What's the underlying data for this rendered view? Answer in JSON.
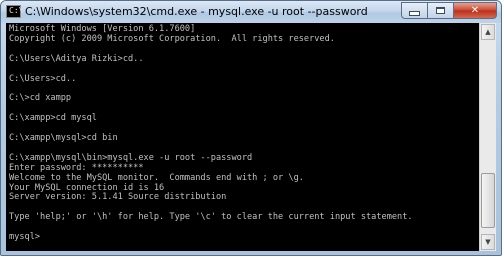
{
  "window": {
    "title": "C:\\Windows\\system32\\cmd.exe - mysql.exe  -u root --password",
    "icon_glyph": "C:\\",
    "buttons": {
      "minimize": "minimize",
      "maximize": "maximize",
      "close": "✕"
    }
  },
  "console": {
    "text_color": "#c0c0c0",
    "background": "#000000",
    "lines": [
      "Microsoft Windows [Version 6.1.7600]",
      "Copyright (c) 2009 Microsoft Corporation.  All rights reserved.",
      "",
      "C:\\Users\\Aditya Rizki>cd..",
      "",
      "C:\\Users>cd..",
      "",
      "C:\\>cd xampp",
      "",
      "C:\\xampp>cd mysql",
      "",
      "C:\\xampp\\mysql>cd bin",
      "",
      "C:\\xampp\\mysql\\bin>mysql.exe -u root --password",
      "Enter password: **********",
      "Welcome to the MySQL monitor.  Commands end with ; or \\g.",
      "Your MySQL connection id is 16",
      "Server version: 5.1.41 Source distribution",
      "",
      "Type 'help;' or '\\h' for help. Type '\\c' to clear the current input statement.",
      "",
      "mysql>"
    ]
  },
  "scrollbar": {
    "up_arrow": "▲",
    "down_arrow": "▼"
  }
}
